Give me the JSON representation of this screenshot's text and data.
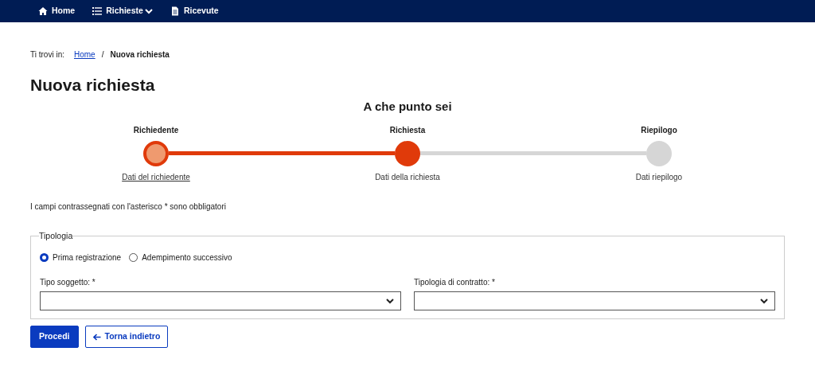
{
  "navbar": {
    "items": [
      {
        "label": "Home",
        "kind": "home",
        "dropdown": false
      },
      {
        "label": "Richieste",
        "kind": "list",
        "dropdown": true
      },
      {
        "label": "Ricevute",
        "kind": "document",
        "dropdown": false
      }
    ]
  },
  "breadcrumb": {
    "prefix": "Ti trovi in:",
    "separator": "/",
    "items": [
      {
        "label": "Home",
        "current": false
      },
      {
        "label": "Nuova richiesta",
        "current": true
      }
    ]
  },
  "page_title": "Nuova richiesta",
  "stepper": {
    "title": "A che punto sei",
    "steps": [
      {
        "label": "Richiedente",
        "caption": "Dati del richiedente",
        "kind": "done"
      },
      {
        "label": "Richiesta",
        "caption": "Dati della richiesta",
        "kind": "current"
      },
      {
        "label": "Riepilogo",
        "caption": "Dati riepilogo",
        "kind": "todo"
      }
    ]
  },
  "required_note": "I campi contrassegnati con l'asterisco * sono obbligatori",
  "fieldset": {
    "legend": "Tipologia",
    "radios": [
      {
        "label": "Prima registrazione",
        "selected": true
      },
      {
        "label": "Adempimento successivo",
        "selected": false
      }
    ],
    "selects": [
      {
        "label": "Tipo soggetto: *"
      },
      {
        "label": "Tipologia di contratto: *"
      }
    ]
  },
  "buttons": [
    {
      "label": "Procedi",
      "kind": "primary"
    },
    {
      "label": "Torna indietro",
      "kind": "back"
    }
  ]
}
